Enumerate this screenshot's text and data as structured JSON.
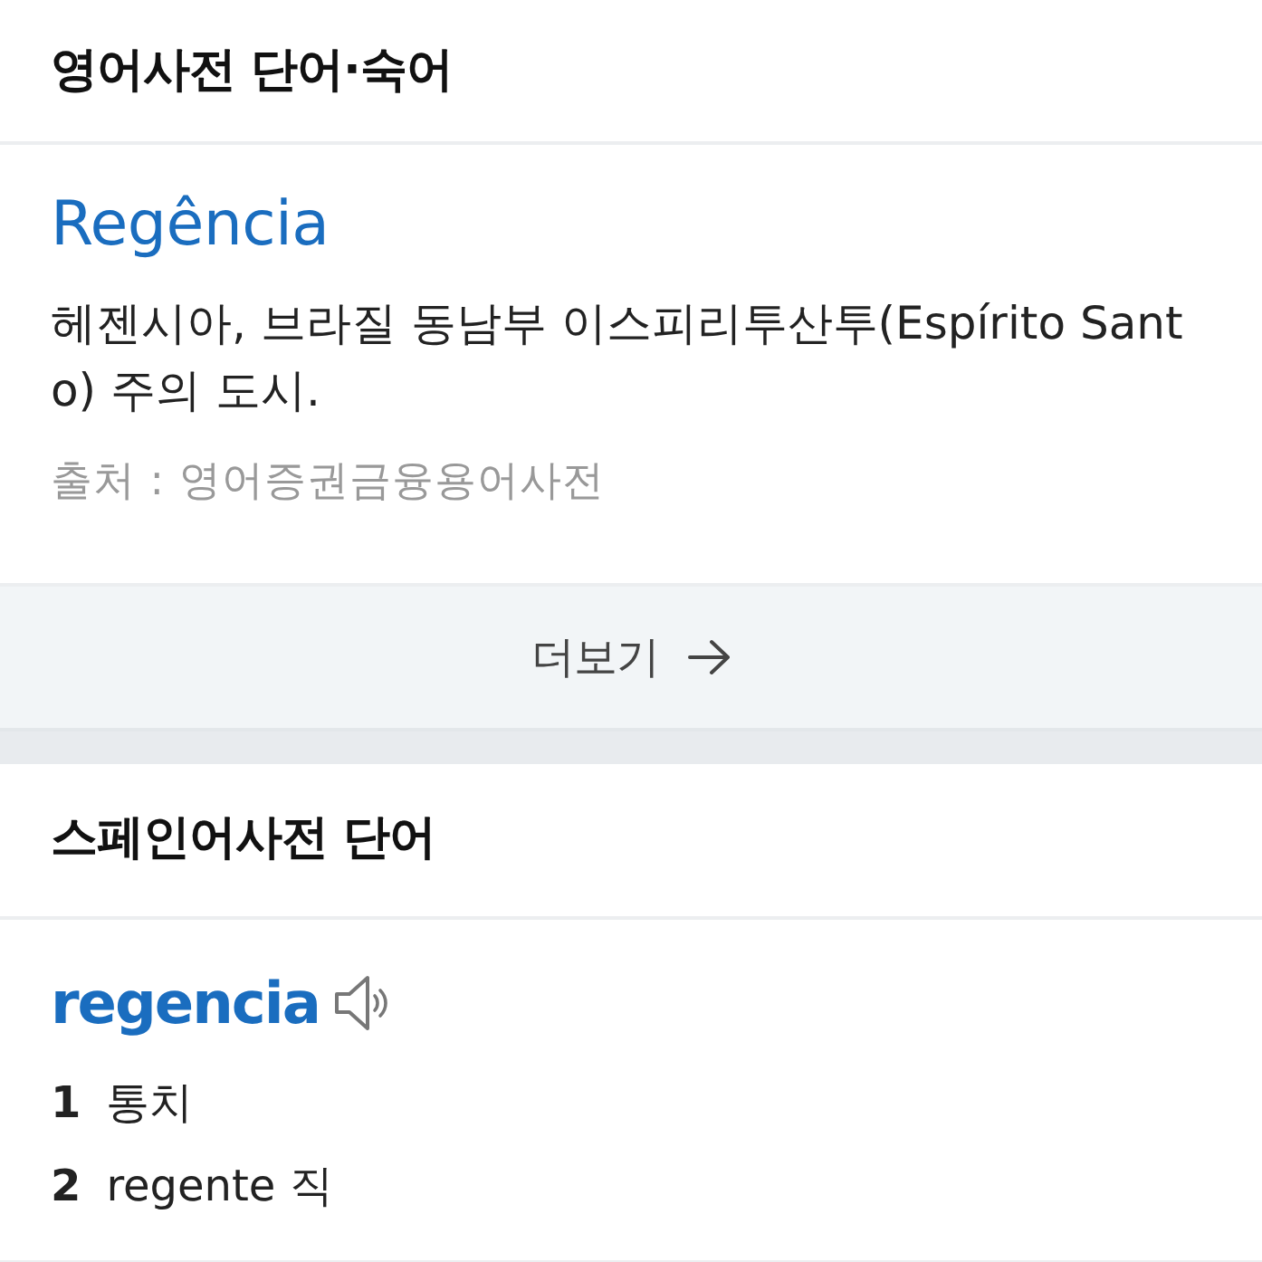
{
  "sections": [
    {
      "title": "영어사전 단어·숙어",
      "entries": [
        {
          "kind": "link",
          "headword": "Regência",
          "definition": "헤젠시아, 브라질 동남부 이스피리투산투(Espírito Santo) 주의 도시.",
          "source": "출처 : 영어증권금융용어사전"
        }
      ],
      "more_button": {
        "label": "더보기"
      }
    },
    {
      "title": "스페인어사전 단어",
      "entries": [
        {
          "kind": "word",
          "headword": "regencia",
          "audio": true,
          "meanings": [
            {
              "number": "1",
              "text": "통치"
            },
            {
              "number": "2",
              "text": "regente 직"
            }
          ]
        }
      ]
    }
  ]
}
